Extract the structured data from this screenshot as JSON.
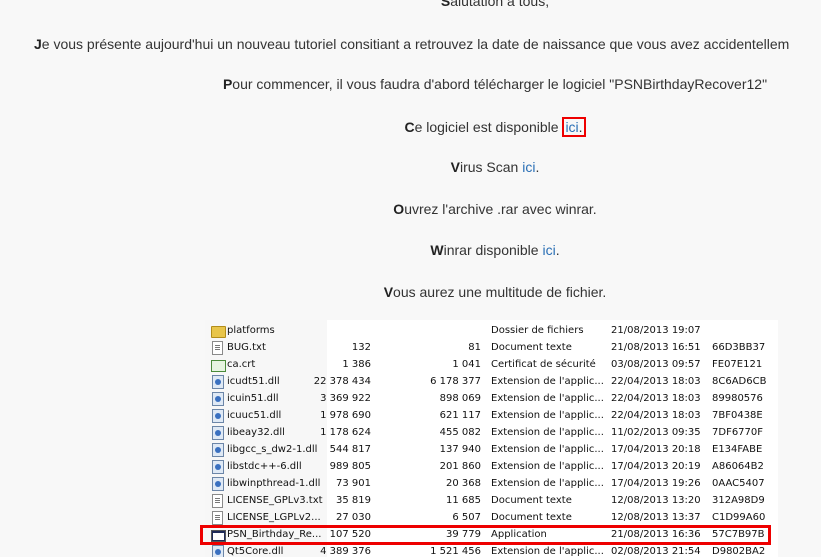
{
  "intro": {
    "salutation_initial": "S",
    "salutation_rest": "alutation à tous,",
    "l1_initial": "J",
    "l1_rest": "e vous présente aujourd'hui un nouveau tutoriel consitiant a retrouvez la date de naissance que vous avez accidentellem",
    "l2_initial": "P",
    "l2_rest": "our commencer, il vous faudra d'abord télécharger le logiciel \"PSNBirthdayRecover12\"",
    "l3_initial": "C",
    "l3_rest": "e logiciel est disponible ",
    "l3_link": "ici",
    "l3_end": ".",
    "l4_initial": "V",
    "l4_rest": "irus Scan ",
    "l4_link": "ici",
    "l4_end": ".",
    "l5_initial": "O",
    "l5_rest": "uvrez l'archive .rar avec winrar.",
    "l6_initial": "W",
    "l6_rest": "inrar disponible ",
    "l6_link": "ici",
    "l6_end": ".",
    "l7_initial": "V",
    "l7_rest": "ous aurez une multitude de fichier."
  },
  "archive": {
    "rows": [
      {
        "name": "platforms",
        "size": "",
        "packed": "",
        "type": "Dossier de fichiers",
        "modified": "21/08/2013 19:07",
        "crc": "",
        "icon": "folder-icon"
      },
      {
        "name": "BUG.txt",
        "size": "132",
        "packed": "81",
        "type": "Document texte",
        "modified": "21/08/2013 16:51",
        "crc": "66D3BB37",
        "icon": "text-file-icon"
      },
      {
        "name": "ca.crt",
        "size": "1 386",
        "packed": "1 041",
        "type": "Certificat de sécurité",
        "modified": "03/08/2013 09:57",
        "crc": "FE07E121",
        "icon": "certificate-icon"
      },
      {
        "name": "icudt51.dll",
        "size": "22 378 434",
        "packed": "6 178 377",
        "type": "Extension de l'applic...",
        "modified": "22/04/2013 18:03",
        "crc": "8C6AD6CB",
        "icon": "dll-icon"
      },
      {
        "name": "icuin51.dll",
        "size": "3 369 922",
        "packed": "898 069",
        "type": "Extension de l'applic...",
        "modified": "22/04/2013 18:03",
        "crc": "89980576",
        "icon": "dll-icon"
      },
      {
        "name": "icuuc51.dll",
        "size": "1 978 690",
        "packed": "621 117",
        "type": "Extension de l'applic...",
        "modified": "22/04/2013 18:03",
        "crc": "7BF0438E",
        "icon": "dll-icon"
      },
      {
        "name": "libeay32.dll",
        "size": "1 178 624",
        "packed": "455 082",
        "type": "Extension de l'applic...",
        "modified": "11/02/2013 09:35",
        "crc": "7DF6770F",
        "icon": "dll-icon"
      },
      {
        "name": "libgcc_s_dw2-1.dll",
        "size": "544 817",
        "packed": "137 940",
        "type": "Extension de l'applic...",
        "modified": "17/04/2013 20:18",
        "crc": "E134FABE",
        "icon": "dll-icon"
      },
      {
        "name": "libstdc++-6.dll",
        "size": "989 805",
        "packed": "201 860",
        "type": "Extension de l'applic...",
        "modified": "17/04/2013 20:19",
        "crc": "A86064B2",
        "icon": "dll-icon"
      },
      {
        "name": "libwinpthread-1.dll",
        "size": "73 901",
        "packed": "20 368",
        "type": "Extension de l'applic...",
        "modified": "17/04/2013 19:26",
        "crc": "0AAC5407",
        "icon": "dll-icon"
      },
      {
        "name": "LICENSE_GPLv3.txt",
        "size": "35 819",
        "packed": "11 685",
        "type": "Document texte",
        "modified": "12/08/2013 13:20",
        "crc": "312A98D9",
        "icon": "text-file-icon"
      },
      {
        "name": "LICENSE_LGPLv2...",
        "size": "27 030",
        "packed": "6 507",
        "type": "Document texte",
        "modified": "12/08/2013 13:37",
        "crc": "C1D99A60",
        "icon": "text-file-icon"
      },
      {
        "name": "PSN_Birthday_Re...",
        "size": "107 520",
        "packed": "39 779",
        "type": "Application",
        "modified": "21/08/2013 16:36",
        "crc": "57C7B97B",
        "icon": "application-icon"
      },
      {
        "name": "Qt5Core.dll",
        "size": "4 389 376",
        "packed": "1 521 456",
        "type": "Extension de l'applic...",
        "modified": "02/08/2013 21:54",
        "crc": "D9802BA2",
        "icon": "dll-icon"
      }
    ]
  },
  "colors": {
    "link": "#2a6fb5",
    "highlight": "#e00000"
  }
}
